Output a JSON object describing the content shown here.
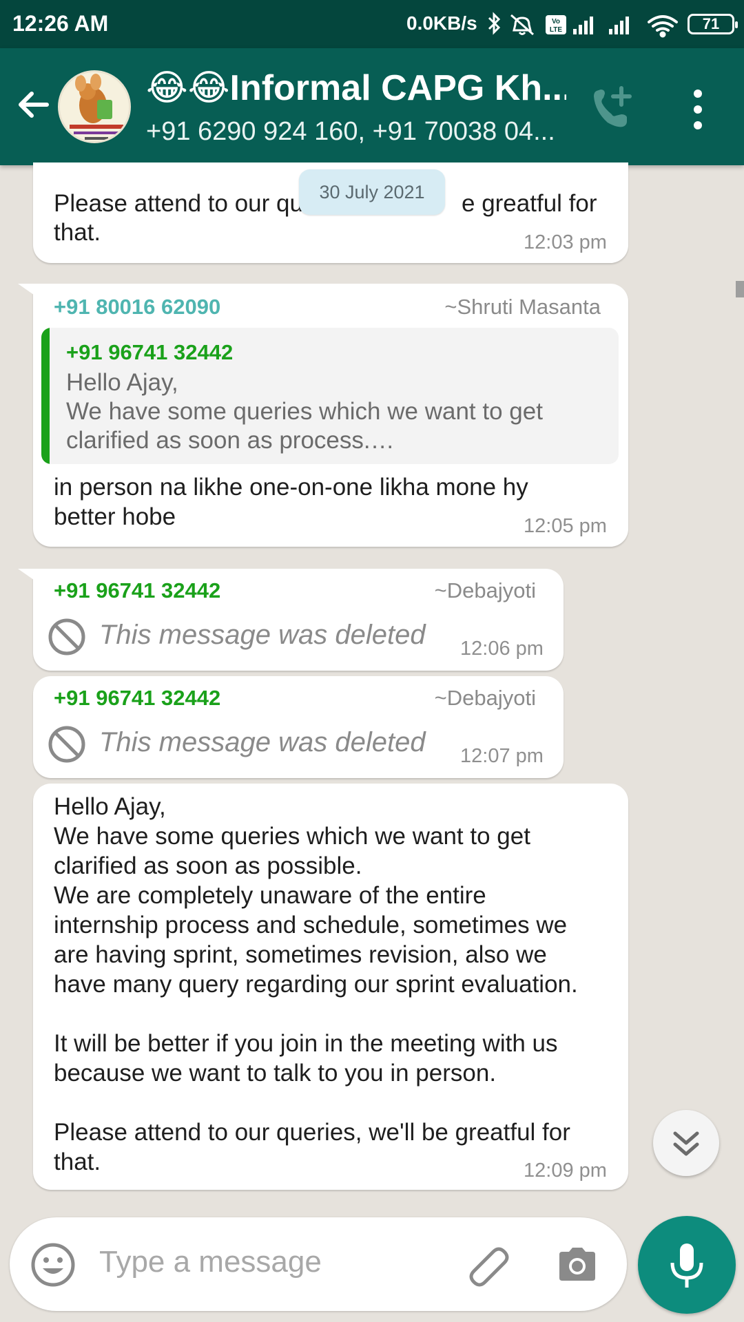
{
  "status_bar": {
    "time": "12:26 AM",
    "net_speed": "0.0KB/s",
    "battery": "71",
    "icons": [
      "bluetooth-icon",
      "mute-icon",
      "volte-icon",
      "signal-icon",
      "signal-icon",
      "wifi-icon",
      "battery-icon"
    ]
  },
  "header": {
    "title": "😂😂Informal CAPG Kh...",
    "subtitle": "+91 6290 924 160, +91 70038 04...",
    "icons": [
      "back-arrow-icon",
      "group-avatar",
      "add-call-icon",
      "more-options-icon"
    ]
  },
  "date_chip": "30 July 2021",
  "messages": [
    {
      "text": "Please attend to our queries, we'll be greatful for that.",
      "visible_line1_left": "Please attend to our qu",
      "visible_line1_right": "e greatful for",
      "visible_line2": "that.",
      "time": "12:03 pm"
    },
    {
      "sender_number": "+91 80016 62090",
      "sender_name": "~Shruti Masanta",
      "sender_color": "#4fb5b0",
      "quote": {
        "number": "+91 96741 32442",
        "line1": "Hello Ajay,",
        "line2": "We have some queries which we want to get",
        "line3": "clarified as soon as process.…"
      },
      "text": "in person na likhe one-on-one likha mone hy\nbetter hobe",
      "time": "12:05 pm"
    },
    {
      "sender_number": "+91 96741 32442",
      "sender_name": "~Debajyoti",
      "sender_color": "#1aa11a",
      "text": "This message was deleted",
      "time": "12:06 pm"
    },
    {
      "sender_number": "+91 96741 32442",
      "sender_name": "~Debajyoti",
      "sender_color": "#1aa11a",
      "text": "This message was deleted",
      "time": "12:07 pm"
    },
    {
      "text": "Hello Ajay,\nWe have some queries which we want to get\nclarified as soon as possible.\nWe are completely unaware of the entire\ninternship process and schedule, sometimes we\nare having sprint, sometimes revision, also we\nhave many query regarding our sprint evaluation.\n\nIt will be better if you join in the meeting with us\nbecause we want to talk to you in person.\n\nPlease attend to our queries, we'll be greatful for\nthat.",
      "time": "12:09 pm"
    }
  ],
  "input": {
    "placeholder": "Type a message"
  },
  "colors": {
    "header": "#075e54",
    "status_bar": "#04463d",
    "chat_bg": "#e6e2dc",
    "mic_button": "#0d8c7d"
  }
}
